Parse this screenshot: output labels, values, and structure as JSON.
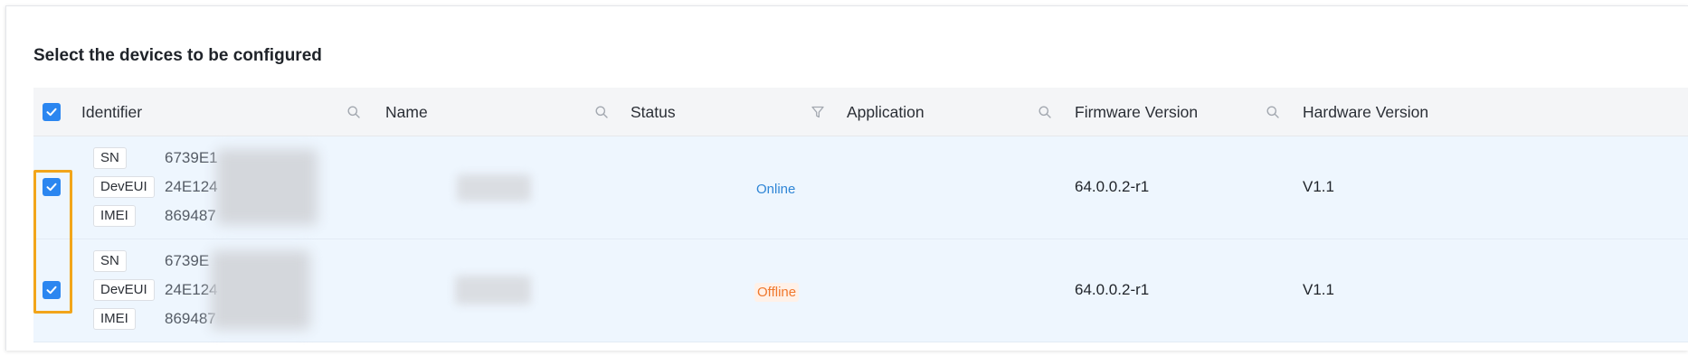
{
  "title": "Select the devices to be configured",
  "columns": {
    "identifier": "Identifier",
    "name": "Name",
    "status": "Status",
    "application": "Application",
    "firmware": "Firmware Version",
    "hardware": "Hardware Version"
  },
  "rows": [
    {
      "checked": true,
      "sn_label": "SN",
      "sn_value": "6739E1",
      "deveui_label": "DevEUI",
      "deveui_value": "24E124",
      "imei_label": "IMEI",
      "imei_value": "869487",
      "status": "Online",
      "application": "",
      "firmware": "64.0.0.2-r1",
      "hardware": "V1.1"
    },
    {
      "checked": true,
      "sn_label": "SN",
      "sn_value": "6739E",
      "deveui_label": "DevEUI",
      "deveui_value": "24E124",
      "imei_label": "IMEI",
      "imei_value": "869487",
      "status": "Offline",
      "application": "",
      "firmware": "64.0.0.2-r1",
      "hardware": "V1.1"
    }
  ],
  "colors": {
    "accent": "#2b86f0",
    "online": "#2f86d6",
    "offline": "#f0782d",
    "highlight": "#f2a51a",
    "row_bg": "#eef6fe"
  }
}
